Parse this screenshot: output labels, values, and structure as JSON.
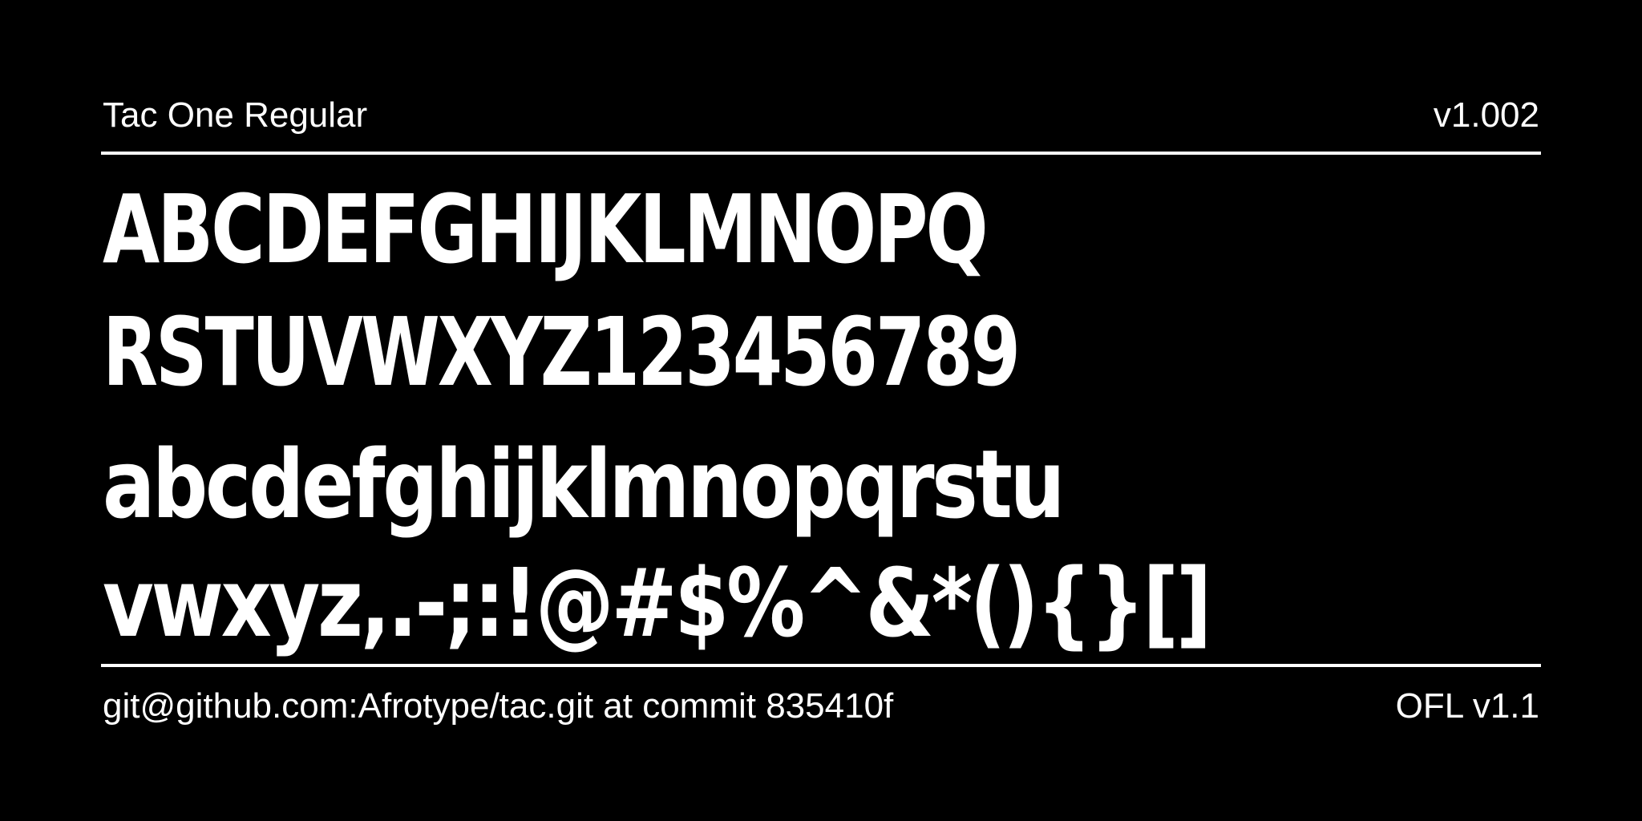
{
  "header": {
    "font_name": "Tac One Regular",
    "version": "v1.002"
  },
  "specimen": {
    "rows": [
      "ABCDEFGHIJKLMNOPQ",
      "RSTUVWXYZ123456789",
      "abcdefghijklmnopqrstu",
      "vwxyz,.-;:!@#$%^&*(){}[]"
    ]
  },
  "footer": {
    "source": "git@github.com:Afrotype/tac.git at commit 835410f",
    "license": "OFL v1.1"
  },
  "colors": {
    "background": "#000000",
    "foreground": "#ffffff"
  }
}
